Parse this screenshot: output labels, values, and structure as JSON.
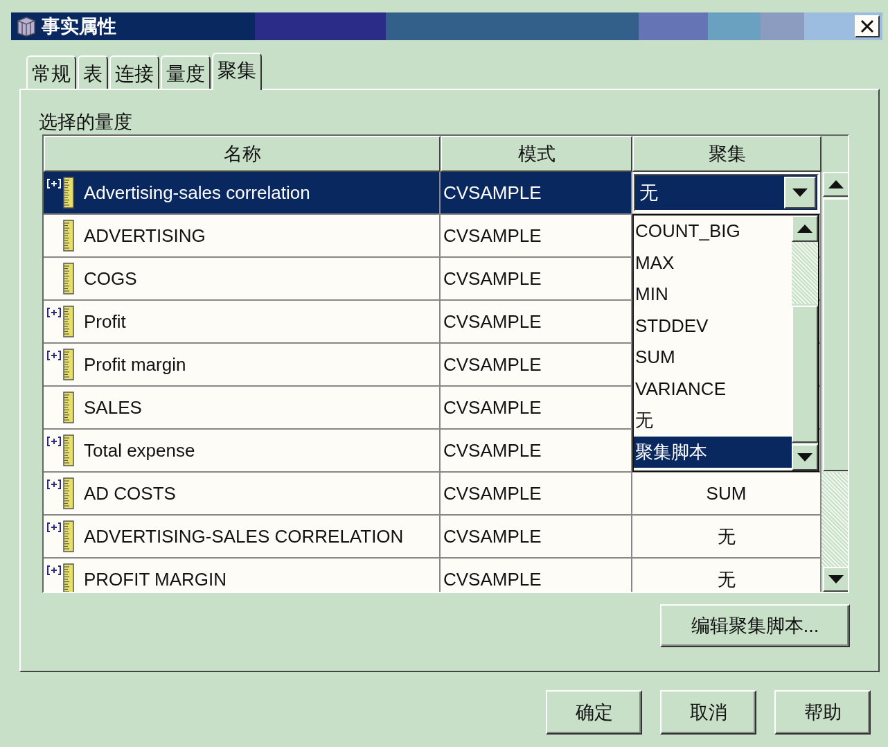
{
  "window": {
    "title": "事实属性"
  },
  "tabs": [
    {
      "label": "常规",
      "selected": false
    },
    {
      "label": "表",
      "selected": false
    },
    {
      "label": "连接",
      "selected": false
    },
    {
      "label": "量度",
      "selected": false
    },
    {
      "label": "聚集",
      "selected": true
    }
  ],
  "section_label": "选择的量度",
  "table": {
    "columns": [
      "名称",
      "模式",
      "聚集"
    ],
    "rows": [
      {
        "name": "Advertising-sales correlation",
        "calculated": true,
        "schema": "CVSAMPLE",
        "selected": true,
        "aggregation": {
          "kind": "combo",
          "value": "无"
        }
      },
      {
        "name": "ADVERTISING",
        "calculated": false,
        "schema": "CVSAMPLE",
        "selected": false
      },
      {
        "name": "COGS",
        "calculated": false,
        "schema": "CVSAMPLE",
        "selected": false
      },
      {
        "name": "Profit",
        "calculated": true,
        "schema": "CVSAMPLE",
        "selected": false
      },
      {
        "name": "Profit margin",
        "calculated": true,
        "schema": "CVSAMPLE",
        "selected": false
      },
      {
        "name": "SALES",
        "calculated": false,
        "schema": "CVSAMPLE",
        "selected": false
      },
      {
        "name": "Total expense",
        "calculated": true,
        "schema": "CVSAMPLE",
        "selected": false
      },
      {
        "name": "AD COSTS",
        "calculated": true,
        "schema": "CVSAMPLE",
        "selected": false,
        "aggregation": {
          "kind": "text",
          "value": "SUM"
        }
      },
      {
        "name": "ADVERTISING-SALES CORRELATION",
        "calculated": true,
        "schema": "CVSAMPLE",
        "selected": false,
        "aggregation": {
          "kind": "text",
          "value": "无"
        }
      },
      {
        "name": "PROFIT MARGIN",
        "calculated": true,
        "schema": "CVSAMPLE",
        "selected": false,
        "aggregation": {
          "kind": "text",
          "value": "无"
        }
      }
    ]
  },
  "dropdown": {
    "items": [
      {
        "label": "COUNT_BIG",
        "selected": false
      },
      {
        "label": "MAX",
        "selected": false
      },
      {
        "label": "MIN",
        "selected": false
      },
      {
        "label": "STDDEV",
        "selected": false
      },
      {
        "label": "SUM",
        "selected": false
      },
      {
        "label": "VARIANCE",
        "selected": false
      },
      {
        "label": "无",
        "selected": false
      },
      {
        "label": "聚集脚本",
        "selected": true
      }
    ]
  },
  "edit_button": "编辑聚集脚本...",
  "buttons": [
    "确定",
    "取消",
    "帮助"
  ]
}
